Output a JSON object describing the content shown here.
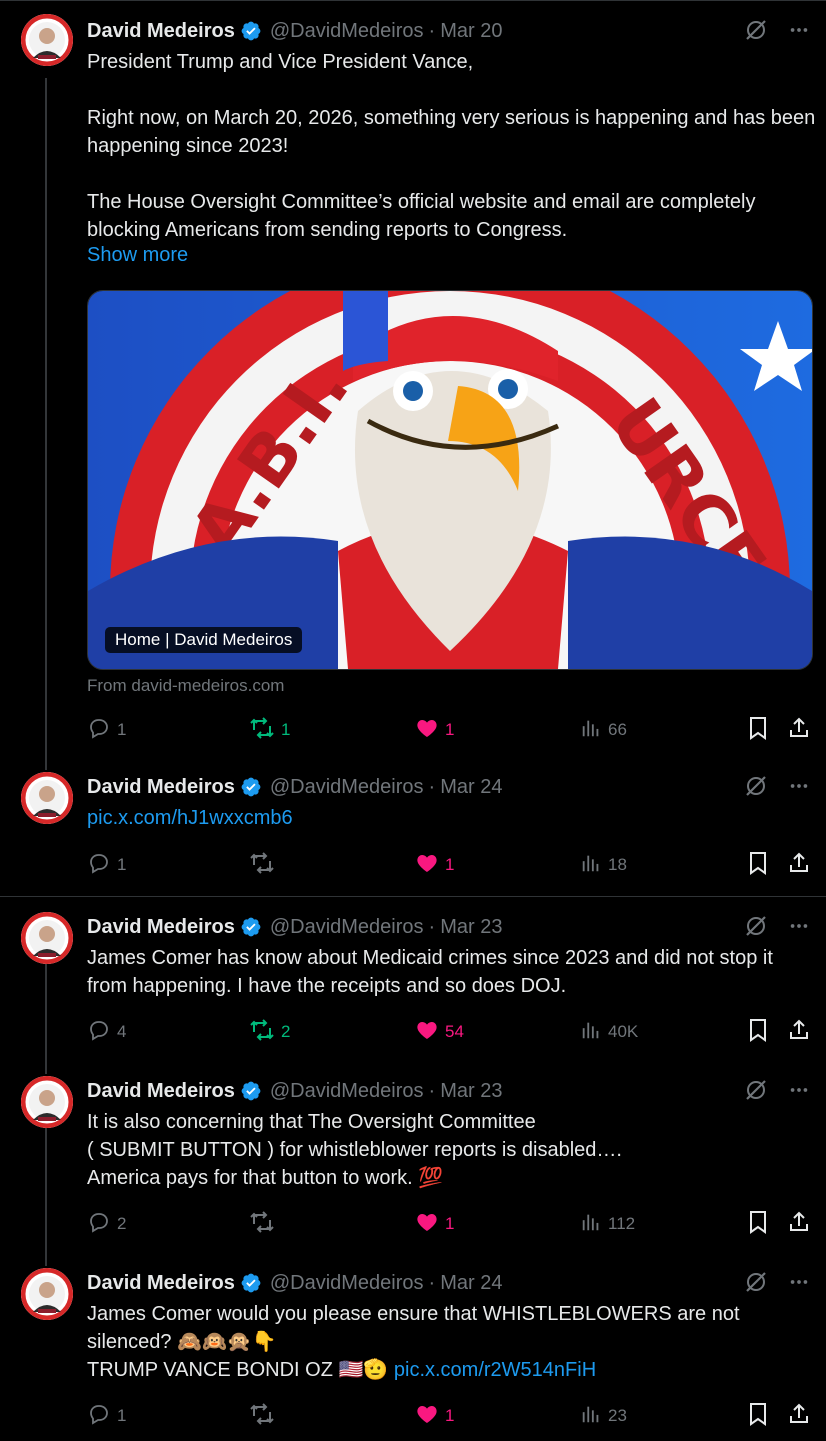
{
  "author": {
    "name": "David Medeiros",
    "handle": "@DavidMedeiros",
    "verified": true,
    "avatar_icon": "avatar-icon"
  },
  "colors": {
    "background": "#000000",
    "text": "#e7e9ea",
    "muted": "#71767b",
    "link": "#1d9bf0",
    "retweet_active": "#00ba7c",
    "like_active": "#f91880",
    "verified": "#1d9bf0"
  },
  "tweets": [
    {
      "date": "Mar 20",
      "text": "President Trump and Vice President Vance,\n\nRight now, on March 20, 2026, something very serious is happening and has been happening since 2023!\n\nThe House Oversight Committee’s official website and email are completely blocking Americans from sending reports to Congress.",
      "show_more": "Show more",
      "card": {
        "label": "Home | David Medeiros",
        "from": "From david-medeiros.com"
      },
      "replies": "1",
      "retweets": "1",
      "likes": "1",
      "views": "66"
    },
    {
      "date": "Mar 24",
      "link": "pic.x.com/hJ1wxxcmb6",
      "replies": "1",
      "retweets": "",
      "likes": "1",
      "views": "18"
    },
    {
      "date": "Mar 23",
      "text": "James Comer has know about Medicaid crimes since 2023 and did not stop it from happening. I have the receipts and so does DOJ.",
      "replies": "4",
      "retweets": "2",
      "likes": "54",
      "views": "40K"
    },
    {
      "date": "Mar 23",
      "text": "It is also concerning that The Oversight Committee\n( SUBMIT BUTTON ) for whistleblower reports is disabled….\nAmerica pays for that button to work. 💯",
      "replies": "2",
      "retweets": "",
      "likes": "1",
      "views": "112"
    },
    {
      "date": "Mar 24",
      "text": "James Comer would you please ensure that WHISTLEBLOWERS are not silenced? 🙈🙉🙊👇\nTRUMP VANCE BONDI OZ  🇺🇸🫡 ",
      "link": "pic.x.com/r2W514nFiH",
      "replies": "1",
      "retweets": "",
      "likes": "1",
      "views": "23"
    }
  ]
}
